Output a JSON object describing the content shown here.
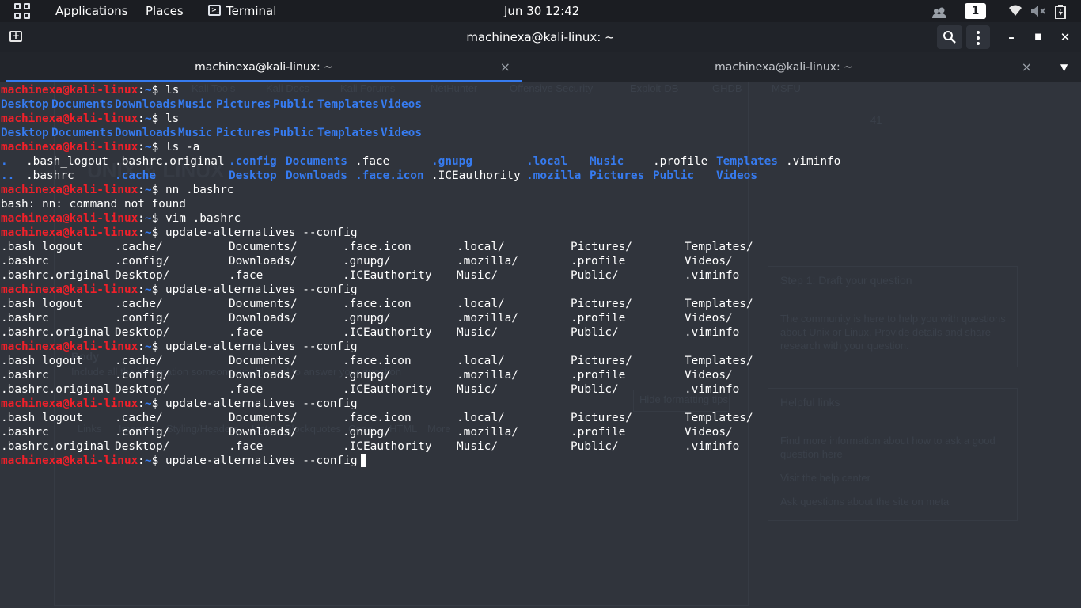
{
  "panel": {
    "applications": "Applications",
    "places": "Places",
    "terminal_app": "Terminal",
    "terminal_icon_glyph": ">_",
    "clock": "Jun 30  12:42",
    "workspace": "1",
    "people_icon": "people-icon",
    "wifi_icon": "wifi-icon",
    "volume_icon": "speaker-muted-icon",
    "battery_icon": "battery-charging-icon"
  },
  "window": {
    "title": "machinexa@kali-linux: ~",
    "new_tab_glyph": "+",
    "minimize": "–",
    "maximize": "■",
    "close": "✕"
  },
  "tabs": [
    {
      "label": "machinexa@kali-linux: ~",
      "close": "×",
      "active": true
    },
    {
      "label": "machinexa@kali-linux: ~",
      "close": "×",
      "active": false
    }
  ],
  "tabs_menu": "▼",
  "prompt": {
    "user": "machinexa@kali-linux",
    "sep": ":",
    "path": "~",
    "sym": "$ "
  },
  "terminal_lines": [
    {
      "type": "prompt",
      "cmd": "ls"
    },
    {
      "type": "cols",
      "cols": [
        [
          "Desktop",
          1
        ],
        [
          "Documents",
          1
        ],
        [
          "Downloads",
          1
        ],
        [
          "Music",
          1
        ],
        [
          "Pictures",
          1
        ],
        [
          "Public",
          1
        ],
        [
          "Templates",
          1
        ],
        [
          "Videos",
          1
        ]
      ],
      "w": [
        8,
        10,
        10,
        6,
        9,
        7,
        10,
        6
      ]
    },
    {
      "type": "prompt",
      "cmd": "ls"
    },
    {
      "type": "cols",
      "cols": [
        [
          "Desktop",
          1
        ],
        [
          "Documents",
          1
        ],
        [
          "Downloads",
          1
        ],
        [
          "Music",
          1
        ],
        [
          "Pictures",
          1
        ],
        [
          "Public",
          1
        ],
        [
          "Templates",
          1
        ],
        [
          "Videos",
          1
        ]
      ],
      "w": [
        8,
        10,
        10,
        6,
        9,
        7,
        10,
        6
      ]
    },
    {
      "type": "prompt",
      "cmd": "ls -a"
    },
    {
      "type": "cols",
      "cols": [
        [
          ".",
          1
        ],
        [
          ".bash_logout",
          0
        ],
        [
          ".bashrc.original",
          0
        ],
        [
          ".config",
          1
        ],
        [
          "Documents",
          1
        ],
        [
          ".face",
          0
        ],
        [
          ".gnupg",
          1
        ],
        [
          ".local",
          1
        ],
        [
          "Music",
          1
        ],
        [
          ".profile",
          0
        ],
        [
          "Templates",
          1
        ],
        [
          ".viminfo",
          0
        ]
      ],
      "w": [
        4,
        14,
        18,
        9,
        11,
        12,
        15,
        10,
        10,
        10,
        11,
        8
      ]
    },
    {
      "type": "cols",
      "cols": [
        [
          "..",
          1
        ],
        [
          ".bashrc",
          0
        ],
        [
          ".cache",
          1
        ],
        [
          "",
          0
        ],
        [
          "Desktop",
          1
        ],
        [
          "Downloads",
          1
        ],
        [
          ".face.icon",
          1
        ],
        [
          ".ICEauthority",
          0
        ],
        [
          ".mozilla",
          1
        ],
        [
          "Pictures",
          1
        ],
        [
          "Public",
          1
        ],
        [
          "Videos",
          1
        ]
      ],
      "w": [
        4,
        14,
        18,
        0,
        9,
        11,
        12,
        15,
        10,
        10,
        10,
        6
      ]
    },
    {
      "type": "prompt",
      "cmd": "nn .bashrc"
    },
    {
      "type": "text",
      "text": "bash: nn: command not found"
    },
    {
      "type": "prompt",
      "cmd": "vim .bashrc"
    },
    {
      "type": "prompt",
      "cmd": "update-alternatives --config"
    },
    {
      "type": "cols",
      "cols": [
        [
          ".bash_logout",
          0
        ],
        [
          ".cache/",
          0
        ],
        [
          "Documents/",
          0
        ],
        [
          ".face.icon",
          0
        ],
        [
          ".local/",
          0
        ],
        [
          "Pictures/",
          0
        ],
        [
          "Templates/",
          0
        ]
      ],
      "w": [
        18,
        18,
        18,
        18,
        18,
        18,
        10
      ]
    },
    {
      "type": "cols",
      "cols": [
        [
          ".bashrc",
          0
        ],
        [
          ".config/",
          0
        ],
        [
          "Downloads/",
          0
        ],
        [
          ".gnupg/",
          0
        ],
        [
          ".mozilla/",
          0
        ],
        [
          ".profile",
          0
        ],
        [
          "Videos/",
          0
        ]
      ],
      "w": [
        18,
        18,
        18,
        18,
        18,
        18,
        10
      ]
    },
    {
      "type": "cols",
      "cols": [
        [
          ".bashrc.original",
          0
        ],
        [
          "Desktop/",
          0
        ],
        [
          ".face",
          0
        ],
        [
          ".ICEauthority",
          0
        ],
        [
          "Music/",
          0
        ],
        [
          "Public/",
          0
        ],
        [
          ".viminfo",
          0
        ]
      ],
      "w": [
        18,
        18,
        18,
        18,
        18,
        18,
        10
      ]
    },
    {
      "type": "prompt",
      "cmd": "update-alternatives --config"
    },
    {
      "type": "cols",
      "cols": [
        [
          ".bash_logout",
          0
        ],
        [
          ".cache/",
          0
        ],
        [
          "Documents/",
          0
        ],
        [
          ".face.icon",
          0
        ],
        [
          ".local/",
          0
        ],
        [
          "Pictures/",
          0
        ],
        [
          "Templates/",
          0
        ]
      ],
      "w": [
        18,
        18,
        18,
        18,
        18,
        18,
        10
      ]
    },
    {
      "type": "cols",
      "cols": [
        [
          ".bashrc",
          0
        ],
        [
          ".config/",
          0
        ],
        [
          "Downloads/",
          0
        ],
        [
          ".gnupg/",
          0
        ],
        [
          ".mozilla/",
          0
        ],
        [
          ".profile",
          0
        ],
        [
          "Videos/",
          0
        ]
      ],
      "w": [
        18,
        18,
        18,
        18,
        18,
        18,
        10
      ]
    },
    {
      "type": "cols",
      "cols": [
        [
          ".bashrc.original",
          0
        ],
        [
          "Desktop/",
          0
        ],
        [
          ".face",
          0
        ],
        [
          ".ICEauthority",
          0
        ],
        [
          "Music/",
          0
        ],
        [
          "Public/",
          0
        ],
        [
          ".viminfo",
          0
        ]
      ],
      "w": [
        18,
        18,
        18,
        18,
        18,
        18,
        10
      ]
    },
    {
      "type": "prompt",
      "cmd": "update-alternatives --config"
    },
    {
      "type": "cols",
      "cols": [
        [
          ".bash_logout",
          0
        ],
        [
          ".cache/",
          0
        ],
        [
          "Documents/",
          0
        ],
        [
          ".face.icon",
          0
        ],
        [
          ".local/",
          0
        ],
        [
          "Pictures/",
          0
        ],
        [
          "Templates/",
          0
        ]
      ],
      "w": [
        18,
        18,
        18,
        18,
        18,
        18,
        10
      ]
    },
    {
      "type": "cols",
      "cols": [
        [
          ".bashrc",
          0
        ],
        [
          ".config/",
          0
        ],
        [
          "Downloads/",
          0
        ],
        [
          ".gnupg/",
          0
        ],
        [
          ".mozilla/",
          0
        ],
        [
          ".profile",
          0
        ],
        [
          "Videos/",
          0
        ]
      ],
      "w": [
        18,
        18,
        18,
        18,
        18,
        18,
        10
      ]
    },
    {
      "type": "cols",
      "cols": [
        [
          ".bashrc.original",
          0
        ],
        [
          "Desktop/",
          0
        ],
        [
          ".face",
          0
        ],
        [
          ".ICEauthority",
          0
        ],
        [
          "Music/",
          0
        ],
        [
          "Public/",
          0
        ],
        [
          ".viminfo",
          0
        ]
      ],
      "w": [
        18,
        18,
        18,
        18,
        18,
        18,
        10
      ]
    },
    {
      "type": "prompt",
      "cmd": "update-alternatives --config"
    },
    {
      "type": "cols",
      "cols": [
        [
          ".bash_logout",
          0
        ],
        [
          ".cache/",
          0
        ],
        [
          "Documents/",
          0
        ],
        [
          ".face.icon",
          0
        ],
        [
          ".local/",
          0
        ],
        [
          "Pictures/",
          0
        ],
        [
          "Templates/",
          0
        ]
      ],
      "w": [
        18,
        18,
        18,
        18,
        18,
        18,
        10
      ]
    },
    {
      "type": "cols",
      "cols": [
        [
          ".bashrc",
          0
        ],
        [
          ".config/",
          0
        ],
        [
          "Downloads/",
          0
        ],
        [
          ".gnupg/",
          0
        ],
        [
          ".mozilla/",
          0
        ],
        [
          ".profile",
          0
        ],
        [
          "Videos/",
          0
        ]
      ],
      "w": [
        18,
        18,
        18,
        18,
        18,
        18,
        10
      ]
    },
    {
      "type": "cols",
      "cols": [
        [
          ".bashrc.original",
          0
        ],
        [
          "Desktop/",
          0
        ],
        [
          ".face",
          0
        ],
        [
          ".ICEauthority",
          0
        ],
        [
          "Music/",
          0
        ],
        [
          "Public/",
          0
        ],
        [
          ".viminfo",
          0
        ]
      ],
      "w": [
        18,
        18,
        18,
        18,
        18,
        18,
        10
      ]
    },
    {
      "type": "prompt",
      "cmd": "update-alternatives --config",
      "cursor": true
    }
  ],
  "background_ghost": {
    "bookmarks": [
      "Kali Tools",
      "Kali Docs",
      "Kali Forums",
      "NetHunter",
      "Offensive Security",
      "Exploit-DB",
      "GHDB",
      "MSFU"
    ],
    "site_title": "UNIX & LINUX",
    "step_title": "Step 1: Draft your question",
    "step_body": "The community is here to help you with questions about Unix or Linux. Provide details and share research with your question.",
    "helpful_links": "Helpful links",
    "help_text_1": "Find more information about how to ask a good question here",
    "help_text_2": "Visit the help center",
    "help_text_3": "Ask questions about the site on meta",
    "body_label": "Body",
    "body_hint": "Include all the information someone would need to answer your question",
    "editor_tabs": [
      "Links",
      "Images",
      "Styling/Headers",
      "Lists",
      "Blockquotes",
      "Code",
      "HTML",
      "More"
    ],
    "format_btn": "Hide formatting tips",
    "rep": "41"
  },
  "colors": {
    "user": "#f1202a",
    "dir": "#367bf0",
    "bg": "#30343c",
    "tab_active": "#367bf0"
  }
}
